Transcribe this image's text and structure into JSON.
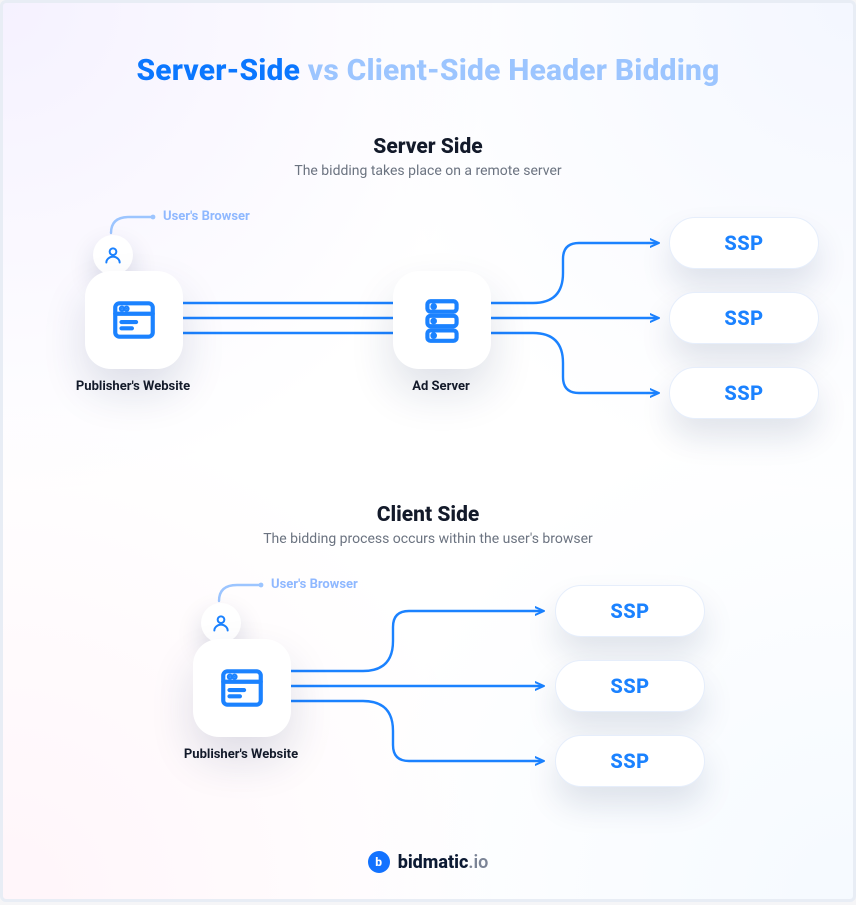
{
  "title": {
    "part1": "Server-Side",
    "part2": " vs Client-Side Header Bidding"
  },
  "sections": {
    "server": {
      "heading": "Server Side",
      "subheading": "The bidding takes place on a remote server",
      "user_caption": "User's Browser",
      "publisher_label": "Publisher's Website",
      "adserver_label": "Ad Server",
      "ssps": [
        "SSP",
        "SSP",
        "SSP"
      ]
    },
    "client": {
      "heading": "Client Side",
      "subheading": "The bidding process occurs within the user's browser",
      "user_caption": "User's Browser",
      "publisher_label": "Publisher's Website",
      "ssps": [
        "SSP",
        "SSP",
        "SSP"
      ]
    }
  },
  "brand": {
    "name": "bidmatic",
    "tld": ".io",
    "badge_letter": "b"
  },
  "colors": {
    "primary": "#0b77ff",
    "soft_blue": "#9cc5ff",
    "text": "#131a2a",
    "muted": "#6b7380"
  }
}
